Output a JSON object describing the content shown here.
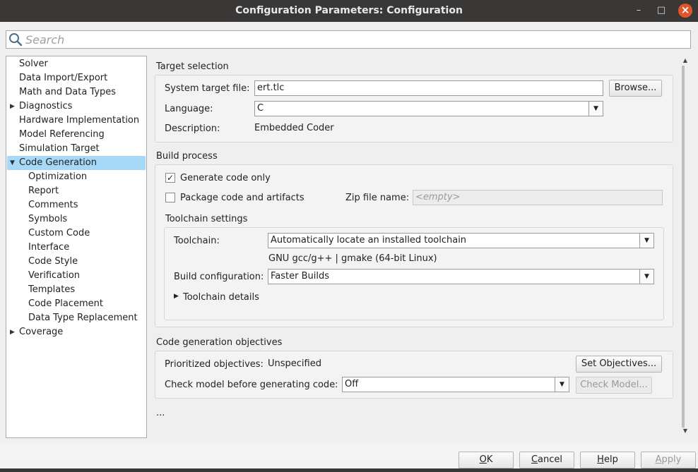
{
  "window": {
    "title": "Configuration Parameters: Configuration",
    "minimize_glyph": "–",
    "maximize_glyph": "□",
    "close_glyph": "×"
  },
  "search": {
    "placeholder": "Search"
  },
  "tree": {
    "items": [
      {
        "label": "Solver"
      },
      {
        "label": "Data Import/Export"
      },
      {
        "label": "Math and Data Types"
      },
      {
        "label": "Diagnostics",
        "expander": "▶"
      },
      {
        "label": "Hardware Implementation"
      },
      {
        "label": "Model Referencing"
      },
      {
        "label": "Simulation Target"
      },
      {
        "label": "Code Generation",
        "expander": "▼",
        "selected": true
      },
      {
        "label": "Optimization"
      },
      {
        "label": "Report"
      },
      {
        "label": "Comments"
      },
      {
        "label": "Symbols"
      },
      {
        "label": "Custom Code"
      },
      {
        "label": "Interface"
      },
      {
        "label": "Code Style"
      },
      {
        "label": "Verification"
      },
      {
        "label": "Templates"
      },
      {
        "label": "Code Placement"
      },
      {
        "label": "Data Type Replacement"
      },
      {
        "label": "Coverage",
        "expander": "▶"
      }
    ]
  },
  "target_selection": {
    "title": "Target selection",
    "system_target_file_label": "System target file:",
    "system_target_file_value": "ert.tlc",
    "browse_label": "Browse...",
    "language_label": "Language:",
    "language_value": "C",
    "description_label": "Description:",
    "description_value": "Embedded Coder"
  },
  "build_process": {
    "title": "Build process",
    "generate_code_only_label": "Generate code only",
    "generate_code_only_checked": "✓",
    "package_code_label": "Package code and artifacts",
    "zip_file_label": "Zip file name:",
    "zip_file_placeholder": "<empty>",
    "toolchain_settings_title": "Toolchain settings",
    "toolchain_label": "Toolchain:",
    "toolchain_value": "Automatically locate an installed toolchain",
    "toolchain_detected": "GNU gcc/g++ | gmake (64-bit Linux)",
    "build_configuration_label": "Build configuration:",
    "build_configuration_value": "Faster Builds",
    "toolchain_details_label": "Toolchain details",
    "toolchain_details_expander": "▶"
  },
  "objectives": {
    "title": "Code generation objectives",
    "prioritized_label": "Prioritized objectives:",
    "prioritized_value": "Unspecified",
    "set_objectives_label": "Set Objectives...",
    "check_model_label": "Check model before generating code:",
    "check_model_value": "Off",
    "check_model_button_label": "Check Model..."
  },
  "more_indicator": "...",
  "combo_arrow_glyph": "▼",
  "scroll": {
    "up_glyph": "▲",
    "down_glyph": "▼"
  },
  "footer": {
    "ok": {
      "mnemonic": "O",
      "rest": "K"
    },
    "cancel": {
      "mnemonic": "C",
      "rest": "ancel"
    },
    "help": {
      "mnemonic": "H",
      "rest": "elp"
    },
    "apply": {
      "mnemonic": "A",
      "rest": "pply"
    }
  }
}
